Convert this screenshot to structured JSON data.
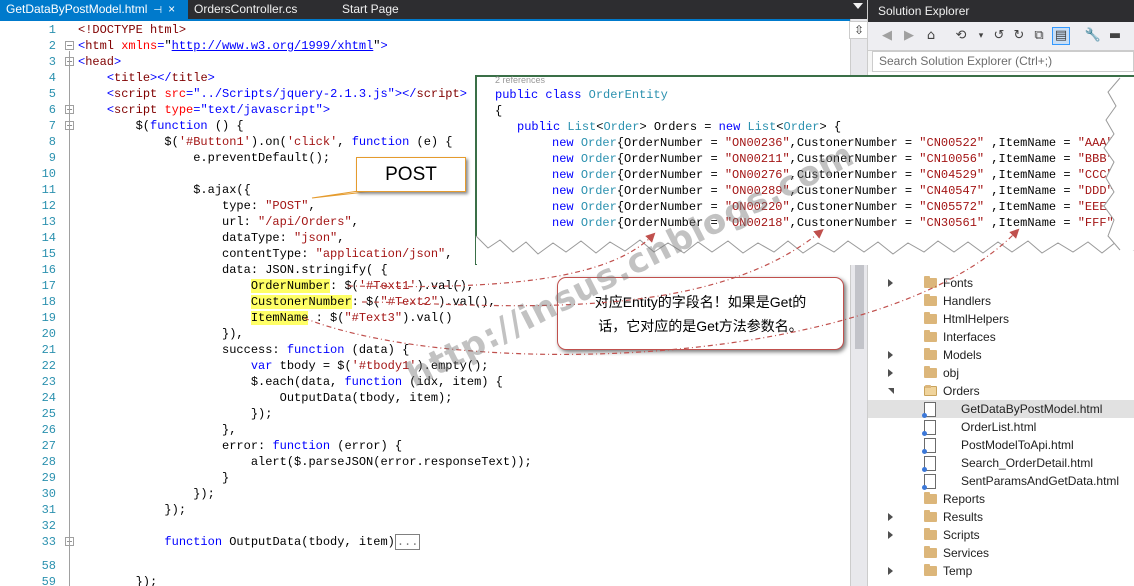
{
  "tabs": [
    {
      "label": "GetDataByPostModel.html",
      "active": true,
      "pin": "⊣",
      "close": "×"
    },
    {
      "label": "OrdersController.cs",
      "active": false
    },
    {
      "label": "Start Page",
      "active": false
    }
  ],
  "editor": {
    "line_numbers": [
      "1",
      "2",
      "3",
      "4",
      "5",
      "6",
      "7",
      "8",
      "9",
      "10",
      "11",
      "12",
      "13",
      "14",
      "15",
      "16",
      "17",
      "18",
      "19",
      "20",
      "21",
      "22",
      "23",
      "24",
      "25",
      "26",
      "27",
      "28",
      "29",
      "30",
      "31",
      "32",
      "33",
      "58",
      "59"
    ],
    "collapsed_marker": "..."
  },
  "solution_explorer": {
    "title": "Solution Explorer",
    "search_placeholder": "Search Solution Explorer (Ctrl+;)",
    "items": [
      {
        "label": "Fonts",
        "type": "folder",
        "expander": "closed"
      },
      {
        "label": "Handlers",
        "type": "folder",
        "expander": "none"
      },
      {
        "label": "HtmlHelpers",
        "type": "folder",
        "expander": "none"
      },
      {
        "label": "Interfaces",
        "type": "folder",
        "expander": "none"
      },
      {
        "label": "Models",
        "type": "folder",
        "expander": "closed"
      },
      {
        "label": "obj",
        "type": "folder",
        "expander": "closed"
      },
      {
        "label": "Orders",
        "type": "folder-open",
        "expander": "open"
      },
      {
        "label": "GetDataByPostModel.html",
        "type": "file",
        "selected": true
      },
      {
        "label": "OrderList.html",
        "type": "file"
      },
      {
        "label": "PostModelToApi.html",
        "type": "file"
      },
      {
        "label": "Search_OrderDetail.html",
        "type": "file"
      },
      {
        "label": "SentParamsAndGetData.html",
        "type": "file"
      },
      {
        "label": "Reports",
        "type": "folder",
        "expander": "none"
      },
      {
        "label": "Results",
        "type": "folder",
        "expander": "closed"
      },
      {
        "label": "Scripts",
        "type": "folder",
        "expander": "closed"
      },
      {
        "label": "Services",
        "type": "folder",
        "expander": "none"
      },
      {
        "label": "Temp",
        "type": "folder",
        "expander": "closed"
      }
    ]
  },
  "callouts": {
    "post_label": "POST",
    "note_line1": "对应Entity的字段名！如果是Get的",
    "note_line2": "话，它对应的是Get方法参数名。",
    "entity_refs": "2 references",
    "watermark": "http://insus.cnblogs.com"
  },
  "entity_orders": [
    {
      "order": "ON00236",
      "customer": "CN00522",
      "item": "AAA"
    },
    {
      "order": "ON00211",
      "customer": "CN10056",
      "item": "BBB"
    },
    {
      "order": "ON00276",
      "customer": "CN04529",
      "item": "CCC"
    },
    {
      "order": "ON00289",
      "customer": "CN40547",
      "item": "DDD"
    },
    {
      "order": "ON00220",
      "customer": "CN05572",
      "item": "EEE"
    },
    {
      "order": "ON00218",
      "customer": "CN30561",
      "item": "FFF"
    }
  ],
  "colors": {
    "tab_active": "#007acc",
    "chrome_dark": "#2d2d30",
    "keyword": "#0000ff",
    "string": "#a31515",
    "type": "#2b91af",
    "highlight": "#ffff66",
    "callout_post_border": "#e59b2d",
    "callout_note_border": "#c0504d",
    "arrow": "#c0504d"
  }
}
